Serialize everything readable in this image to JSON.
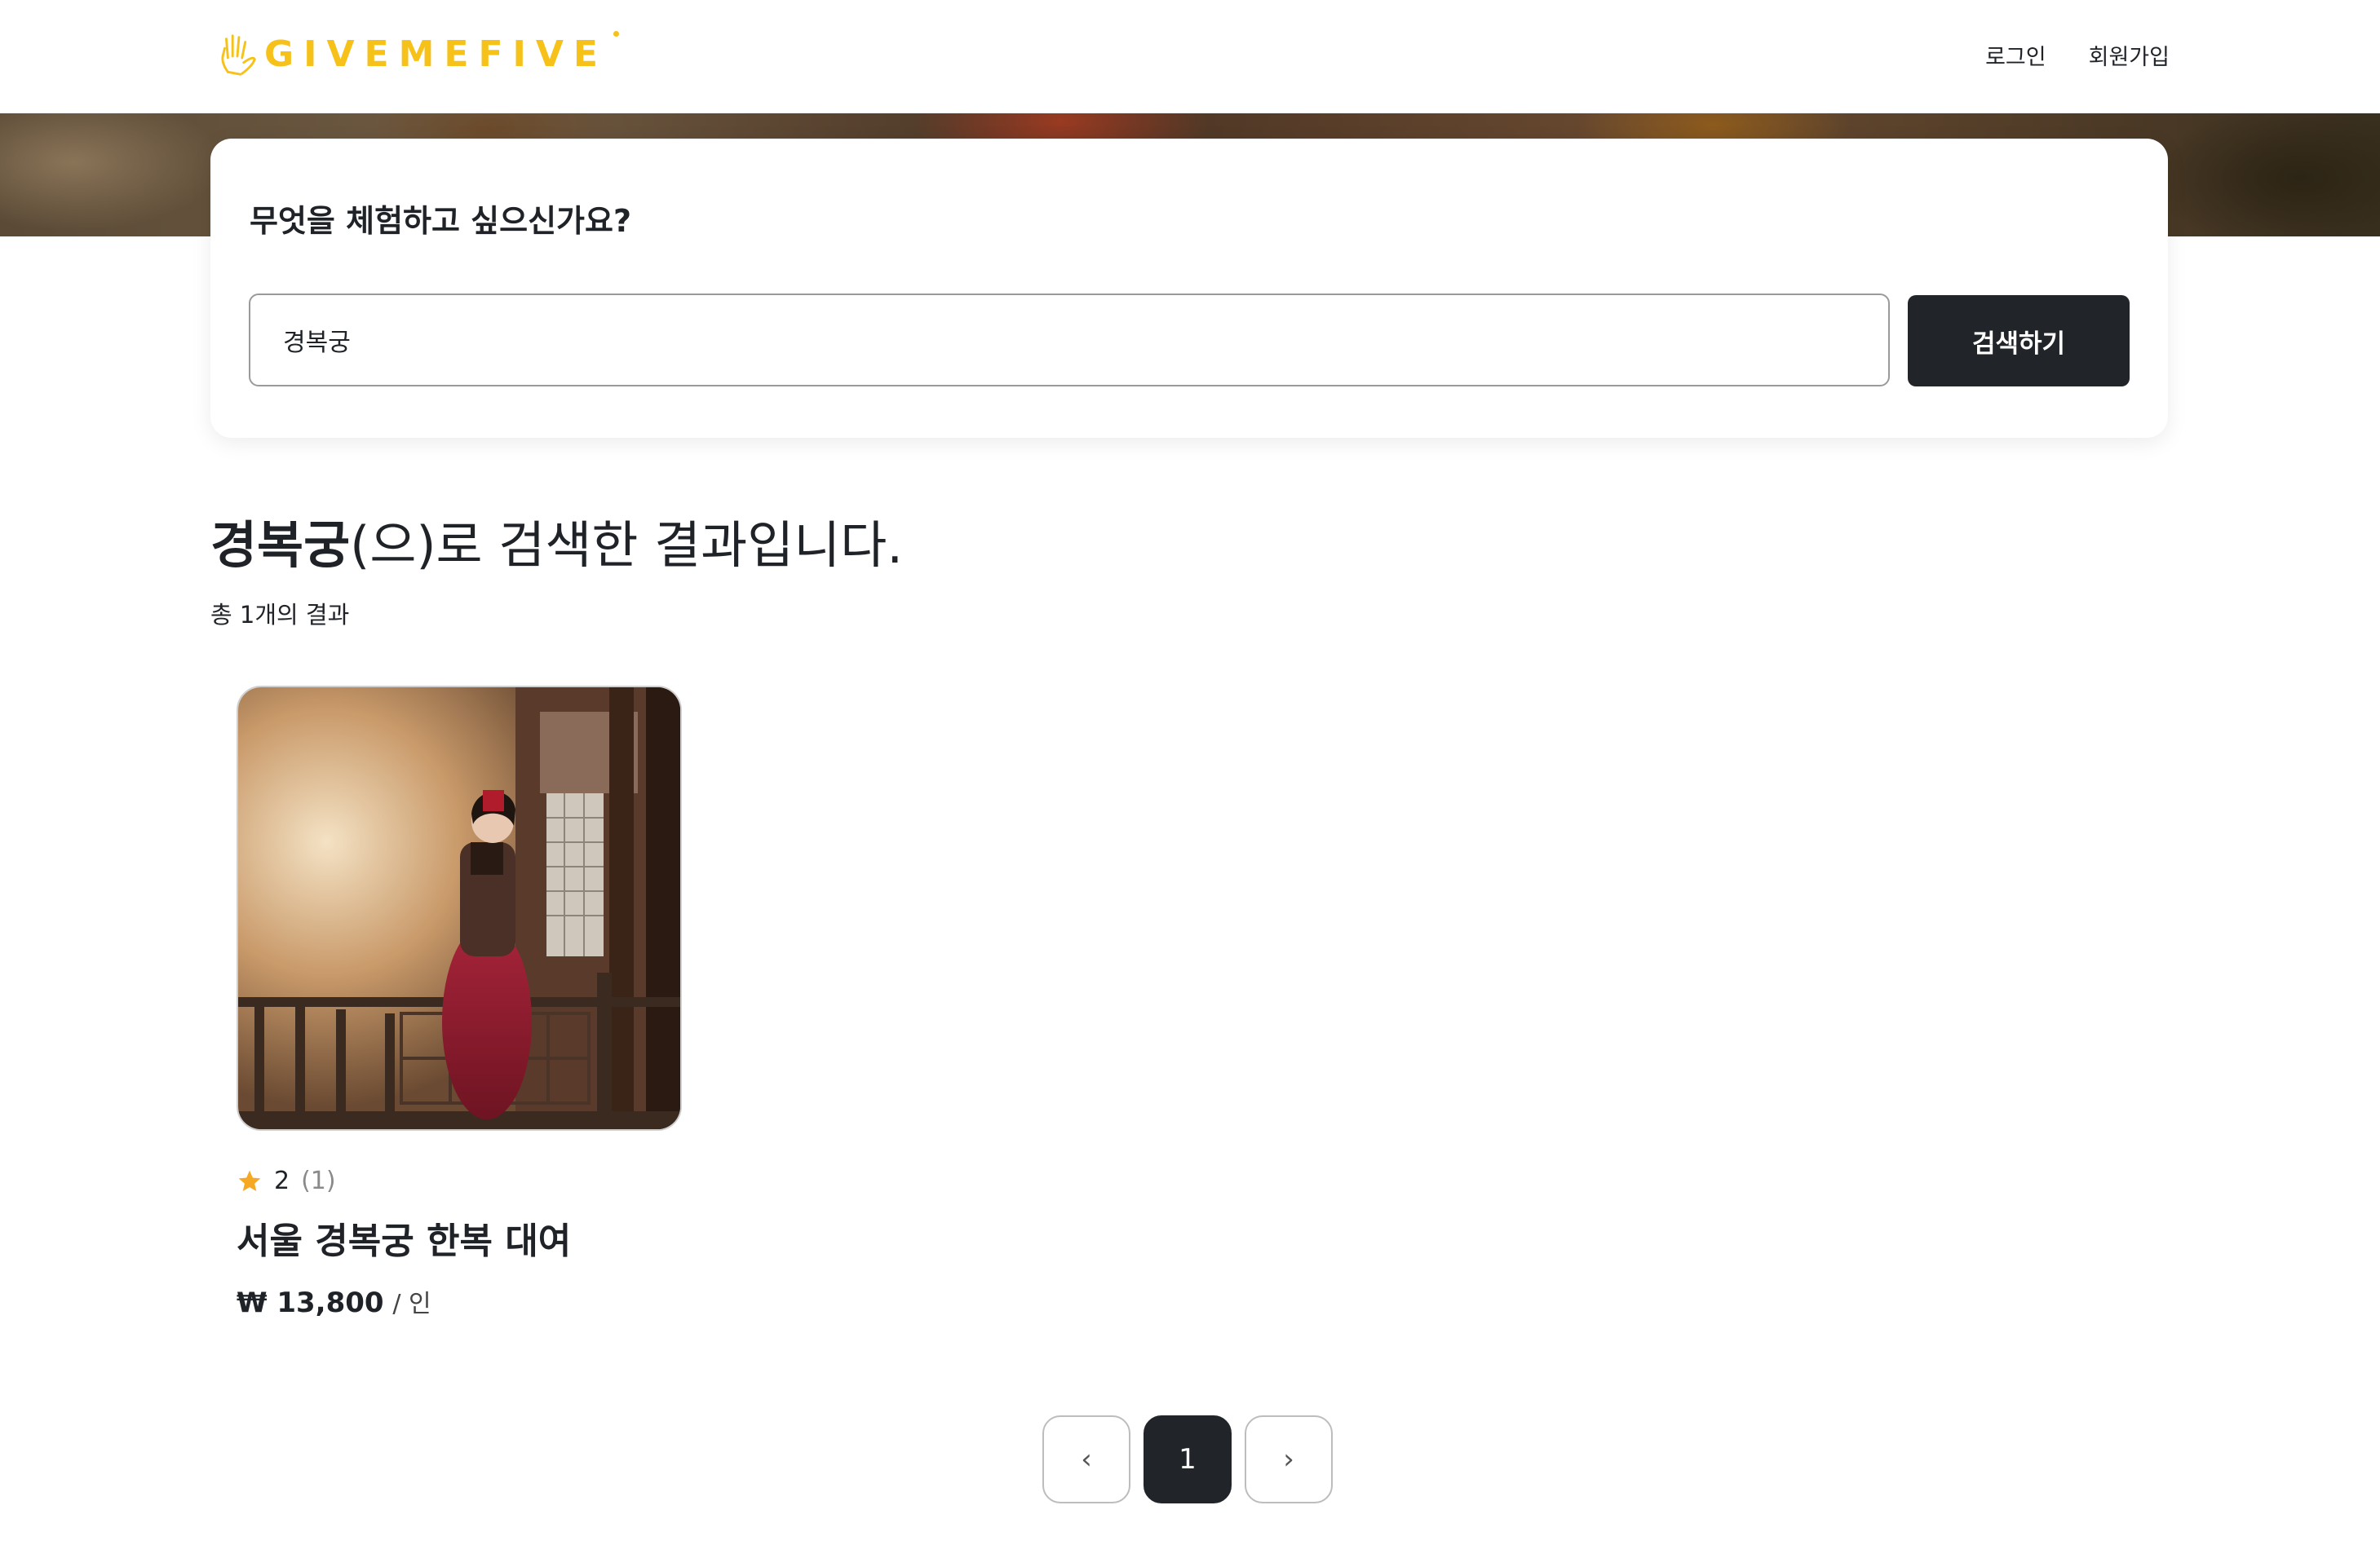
{
  "header": {
    "logo_text": "GIVEMEFIVE",
    "login_label": "로그인",
    "signup_label": "회원가입"
  },
  "search": {
    "title": "무엇을 체험하고 싶으신가요?",
    "value": "경복궁",
    "button_label": "검색하기"
  },
  "results": {
    "keyword": "경복궁",
    "heading_suffix": "(으)로 검색한 결과입니다.",
    "count_text": "총 1개의 결과"
  },
  "items": [
    {
      "rating": "2",
      "review_count": "(1)",
      "title": "서울 경복궁 한복 대여",
      "price": "₩ 13,800",
      "price_unit": "/ 인"
    }
  ],
  "pagination": {
    "prev_icon": "‹",
    "current_page": "1",
    "next_icon": "›"
  },
  "colors": {
    "brand": "#f6c21a",
    "button_dark": "#212529",
    "star": "#f7a823"
  }
}
